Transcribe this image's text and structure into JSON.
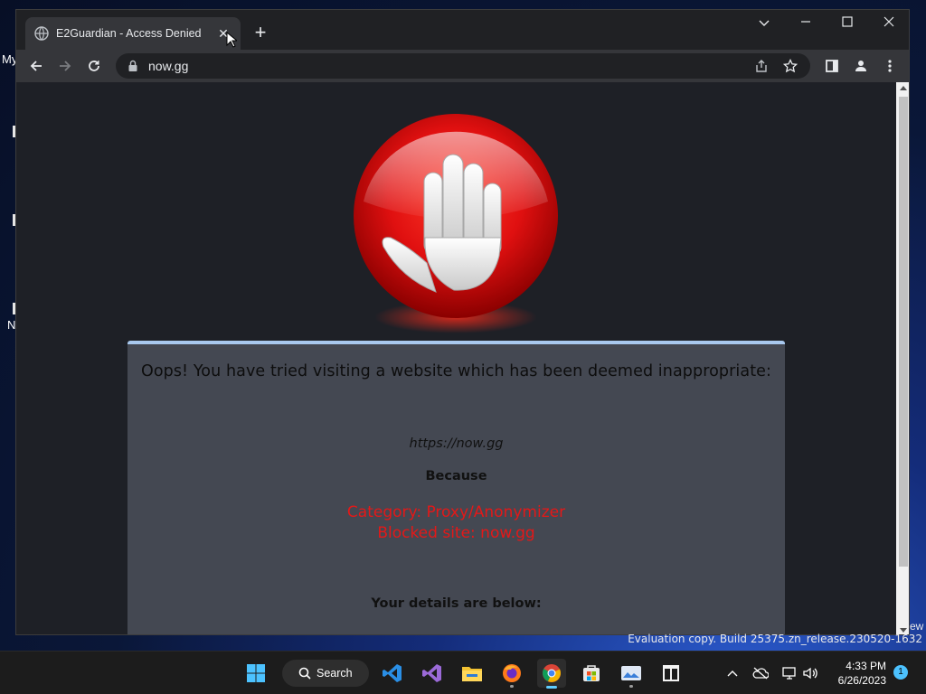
{
  "desktop": {
    "labels": [
      "My",
      "N"
    ],
    "edge_text": "ew"
  },
  "browser": {
    "tab_title": "E2Guardian - Access Denied",
    "url": "now.gg"
  },
  "page": {
    "heading": "Oops! You have tried visiting a website which has been deemed inappropriate:",
    "blocked_url": "https://now.gg",
    "because": "Because",
    "category": "Category: Proxy/Anonymizer",
    "blocked_site": "Blocked site: now.gg",
    "details": "Your details are below:"
  },
  "watermark": "Evaluation copy. Build 25375.zn_release.230520-1632",
  "taskbar": {
    "search_label": "Search",
    "time": "4:33 PM",
    "date": "6/26/2023",
    "notification_count": "1"
  },
  "colors": {
    "reason_text": "#e41818",
    "panel_bg": "#444852",
    "panel_border": "#a8c8ee"
  }
}
